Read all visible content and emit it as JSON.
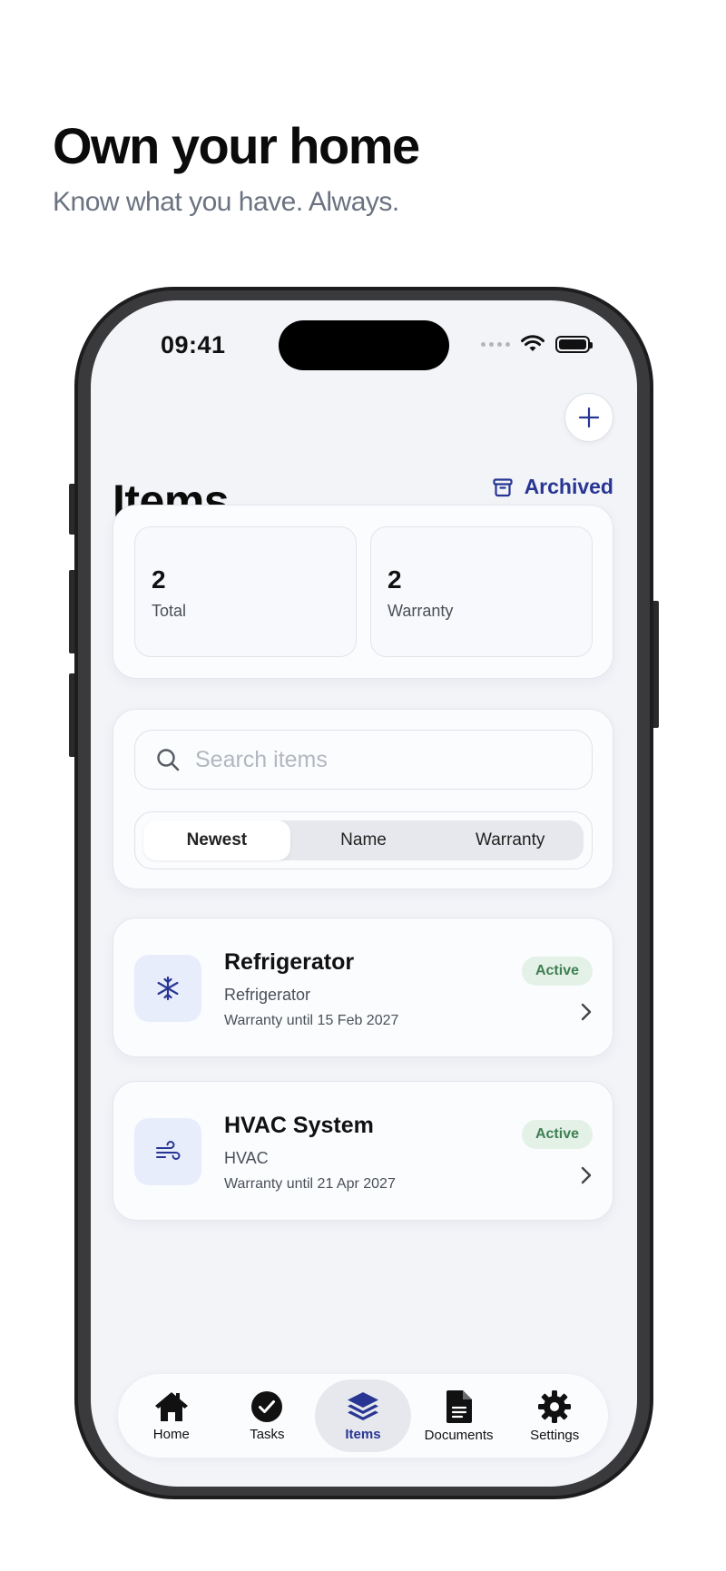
{
  "promo": {
    "headline": "Own your home",
    "subline": "Know what you have. Always."
  },
  "status_bar": {
    "time": "09:41"
  },
  "header": {
    "title": "Items",
    "archived_label": "Archived",
    "add_icon": "plus-icon"
  },
  "stats": [
    {
      "value": "2",
      "label": "Total"
    },
    {
      "value": "2",
      "label": "Warranty"
    }
  ],
  "search": {
    "placeholder": "Search items"
  },
  "sort": {
    "options": [
      "Newest",
      "Name",
      "Warranty"
    ],
    "selected": "Newest"
  },
  "items": [
    {
      "name": "Refrigerator",
      "category": "Refrigerator",
      "warranty": "Warranty until 15 Feb 2027",
      "status": "Active",
      "icon": "snowflake-icon"
    },
    {
      "name": "HVAC System",
      "category": "HVAC",
      "warranty": "Warranty until 21 Apr 2027",
      "status": "Active",
      "icon": "wind-icon"
    }
  ],
  "tabbar": {
    "tabs": [
      {
        "label": "Home",
        "icon": "house-icon"
      },
      {
        "label": "Tasks",
        "icon": "checkmark-circle-icon"
      },
      {
        "label": "Items",
        "icon": "stack-icon"
      },
      {
        "label": "Documents",
        "icon": "document-icon"
      },
      {
        "label": "Settings",
        "icon": "gear-icon"
      }
    ],
    "active": "Items"
  },
  "colors": {
    "accent": "#283593",
    "background": "#f2f4f8",
    "badge_bg": "#e3f1e7",
    "badge_text": "#3f7f52"
  }
}
